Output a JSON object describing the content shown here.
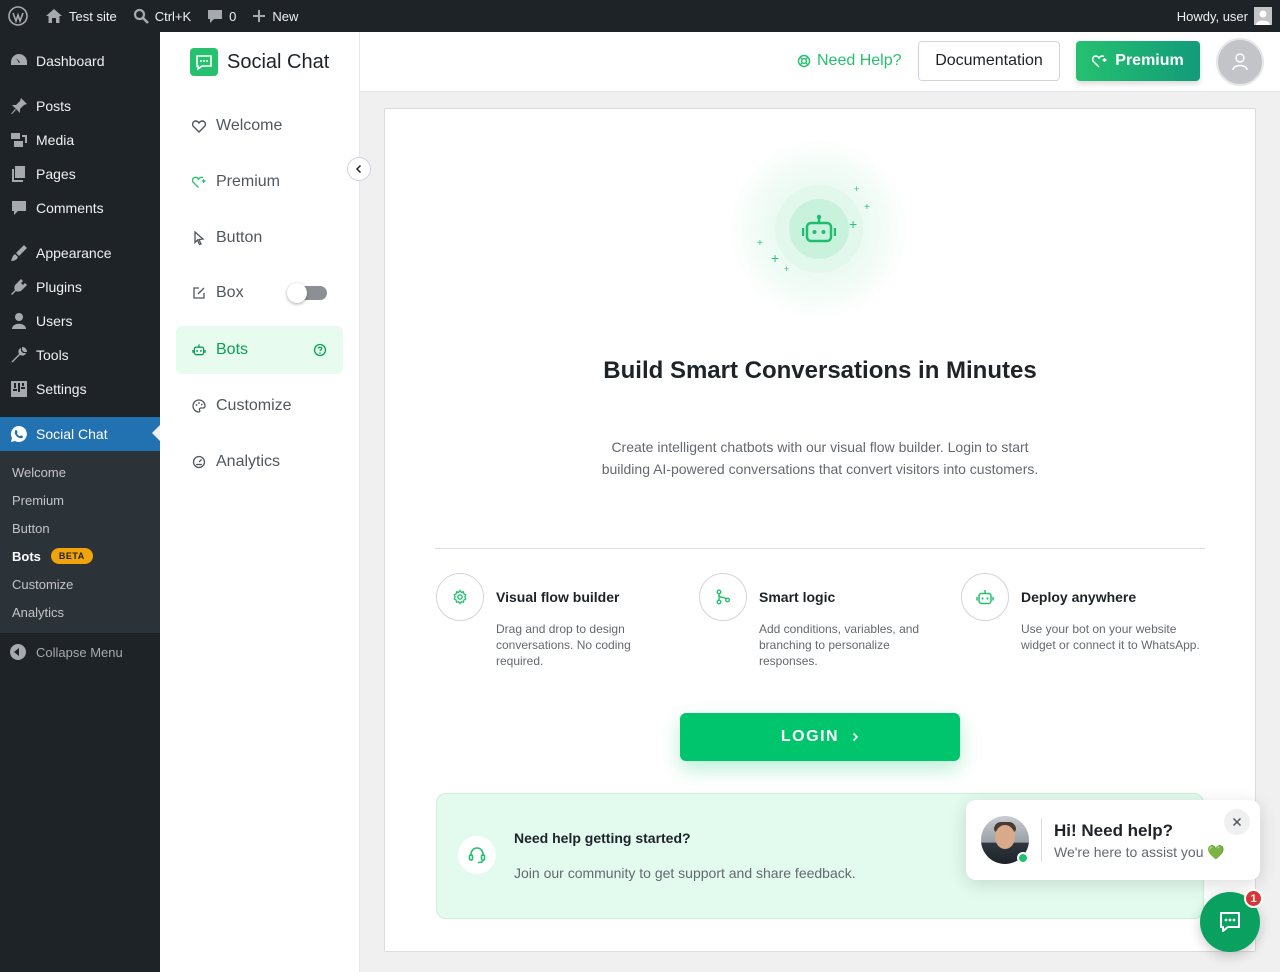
{
  "admin_bar": {
    "site_name": "Test site",
    "search_shortcut": "Ctrl+K",
    "comments_count": "0",
    "new_label": "New",
    "greeting": "Howdy, user"
  },
  "admin_menu": {
    "items": [
      {
        "label": "Dashboard",
        "icon": "dashboard-icon"
      },
      {
        "label": "Posts",
        "icon": "pin-icon"
      },
      {
        "label": "Media",
        "icon": "media-icon"
      },
      {
        "label": "Pages",
        "icon": "pages-icon"
      },
      {
        "label": "Comments",
        "icon": "comment-icon"
      },
      {
        "label": "Appearance",
        "icon": "brush-icon"
      },
      {
        "label": "Plugins",
        "icon": "plug-icon"
      },
      {
        "label": "Users",
        "icon": "user-icon"
      },
      {
        "label": "Tools",
        "icon": "wrench-icon"
      },
      {
        "label": "Settings",
        "icon": "settings-icon"
      },
      {
        "label": "Social Chat",
        "icon": "whatsapp-icon"
      }
    ],
    "submenu": [
      "Welcome",
      "Premium",
      "Button",
      "Bots",
      "Customize",
      "Analytics"
    ],
    "active_submenu": "Bots",
    "beta_badge": "BETA",
    "collapse_label": "Collapse Menu"
  },
  "plugin": {
    "name": "Social Chat",
    "nav": [
      {
        "label": "Welcome",
        "icon": "heart-icon"
      },
      {
        "label": "Premium",
        "icon": "premium-heart-icon"
      },
      {
        "label": "Button",
        "icon": "cursor-icon"
      },
      {
        "label": "Box",
        "icon": "edit-box-icon",
        "toggle_on": false
      },
      {
        "label": "Bots",
        "icon": "robot-icon",
        "active": true
      },
      {
        "label": "Customize",
        "icon": "palette-icon"
      },
      {
        "label": "Analytics",
        "icon": "gauge-icon"
      }
    ]
  },
  "header": {
    "need_help": "Need Help?",
    "documentation": "Documentation",
    "premium": "Premium"
  },
  "main": {
    "headline": "Build Smart Conversations in Minutes",
    "subtext": "Create intelligent chatbots with our visual flow builder. Login to start building AI-powered conversations that convert visitors into customers.",
    "features": [
      {
        "title": "Visual flow builder",
        "desc": "Drag and drop to design conversations. No coding required.",
        "icon": "gear-icon"
      },
      {
        "title": "Smart logic",
        "desc": "Add conditions, variables, and branching to personalize responses.",
        "icon": "branch-icon"
      },
      {
        "title": "Deploy anywhere",
        "desc": "Use your bot on your website widget or connect it to WhatsApp.",
        "icon": "robot-icon"
      }
    ],
    "login_label": "LOGIN",
    "help_title": "Need help getting started?",
    "help_text": "Join our community to get support and share feedback."
  },
  "chat_widget": {
    "title": "Hi! Need help?",
    "subtitle": "We're here to assist you 💚",
    "badge_count": "1"
  },
  "colors": {
    "accent": "#25c16f",
    "wp_active": "#2271b1",
    "wp_dark": "#1d2327"
  }
}
